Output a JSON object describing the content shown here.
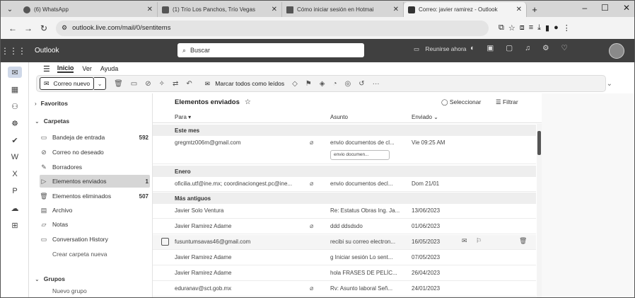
{
  "browser": {
    "tabs": [
      {
        "title": "(6) WhatsApp",
        "active": false
      },
      {
        "title": "(1) Trío Los Panchos, Trío Vegas",
        "active": false
      },
      {
        "title": "Cómo iniciar sesión en Hotmai",
        "active": false
      },
      {
        "title": "Correo: javier ramirez - Outlook",
        "active": true
      }
    ],
    "url": "outlook.live.com/mail/0/sentitems"
  },
  "outlook": {
    "app_name": "Outlook",
    "search_placeholder": "Buscar",
    "meet_label": "Reunirse ahora"
  },
  "menu": {
    "items": [
      "Inicio",
      "Ver",
      "Ayuda"
    ],
    "selected": "Inicio"
  },
  "ribbon": {
    "new_mail": "Correo nuevo",
    "mark_all_read": "Marcar todos como leídos"
  },
  "folders": {
    "favorites_label": "Favoritos",
    "folders_label": "Carpetas",
    "items": [
      {
        "label": "Bandeja de entrada",
        "count": "592",
        "icon": "inbox-icon"
      },
      {
        "label": "Correo no deseado",
        "count": "",
        "icon": "junk-icon"
      },
      {
        "label": "Borradores",
        "count": "",
        "icon": "drafts-icon"
      },
      {
        "label": "Elementos enviados",
        "count": "1",
        "icon": "sent-icon",
        "selected": true
      },
      {
        "label": "Elementos eliminados",
        "count": "507",
        "icon": "trash-icon"
      },
      {
        "label": "Archivo",
        "count": "",
        "icon": "archive-icon"
      },
      {
        "label": "Notas",
        "count": "",
        "icon": "notes-icon"
      },
      {
        "label": "Conversation History",
        "count": "",
        "icon": "folder-icon"
      }
    ],
    "create_folder": "Crear carpeta nueva",
    "groups_label": "Grupos",
    "new_group": "Nuevo grupo"
  },
  "list": {
    "title": "Elementos enviados",
    "select_label": "Seleccionar",
    "filter_label": "Filtrar",
    "columns": {
      "to": "Para",
      "subject": "Asunto",
      "sent": "Enviado"
    },
    "groups": {
      "this_month": "Este mes",
      "january": "Enero",
      "older": "Más antiguos"
    },
    "rows": [
      {
        "sender": "gregmtz006m@gmail.com",
        "subject": "envio documentos de cl...",
        "date": "Vie 09:25 AM",
        "attachment": "envio documen..."
      },
      {
        "sender": "oficilia.utf@ine.mx; coordinaciongest.pc@ine...",
        "subject": "envio documentos decl...",
        "date": "Dom 21/01"
      },
      {
        "sender": "Javier Solo Ventura",
        "subject": "Re: Estatus Obras Ing. Ja...",
        "date": "13/06/2023"
      },
      {
        "sender": "Javier Ramirez Adame",
        "subject": "ddd  ddsdsdo",
        "date": "01/06/2023"
      },
      {
        "sender": "fusuntumsavas46@gmail.com",
        "subject": "recibi su correo electron...",
        "date": "16/05/2023"
      },
      {
        "sender": "Javier Ramirez Adame",
        "subject": "g  Iniciar sesión Lo sent...",
        "date": "07/05/2023"
      },
      {
        "sender": "Javier Ramirez Adame",
        "subject": "hola  FRASES DE PELÍC...",
        "date": "26/04/2023"
      },
      {
        "sender": "eduranav@sct.gob.mx",
        "subject": "Rv: Asunto laboral  Señ...",
        "date": "24/01/2023"
      }
    ]
  }
}
